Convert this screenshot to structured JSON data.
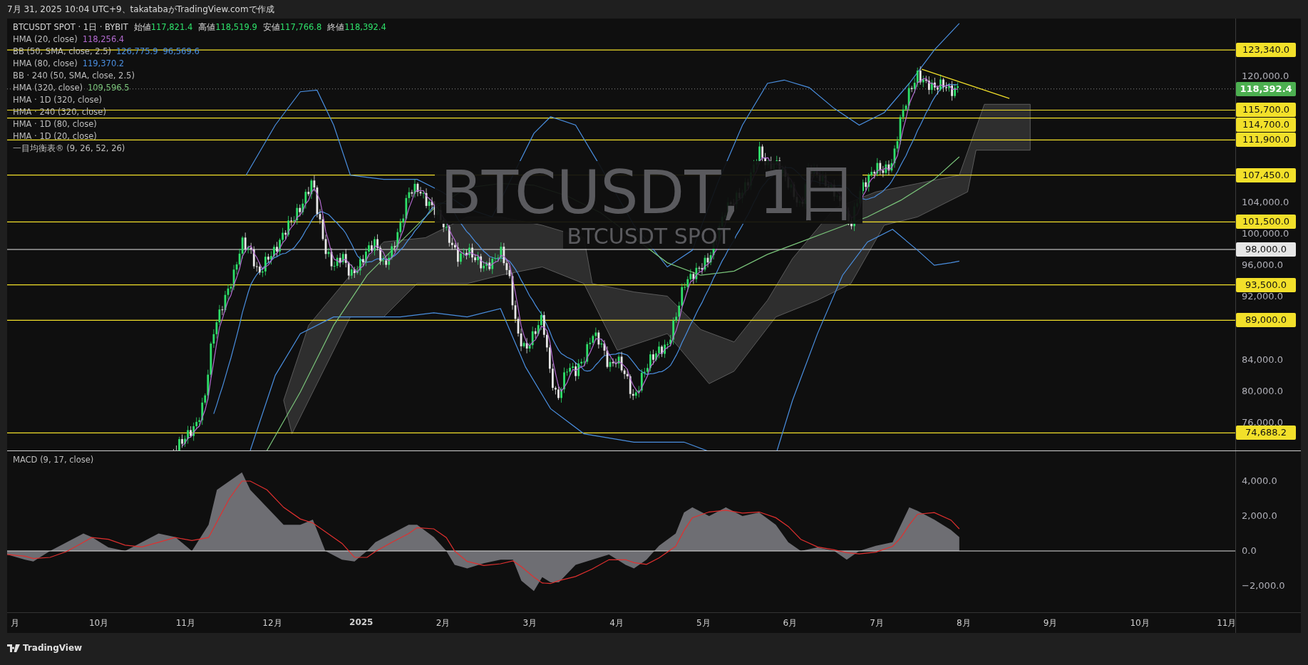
{
  "header": {
    "caption": "7月 31, 2025 10:04 UTC+9、takatabaがTradingView.comで作成"
  },
  "legend": {
    "symbol": "BTCUSDT SPOT · 1日 · BYBIT",
    "ohlc": [
      {
        "label": "始値",
        "value": "117,821.4"
      },
      {
        "label": "高値",
        "value": "118,519.9"
      },
      {
        "label": "安値",
        "value": "117,766.8"
      },
      {
        "label": "終値",
        "value": "118,392.4"
      }
    ],
    "indicators": [
      {
        "name": "HMA (20, close)",
        "values": [
          {
            "text": "118,256.4",
            "color": "#b36ad0"
          }
        ]
      },
      {
        "name": "BB (50, SMA, close, 2.5)",
        "values": [
          {
            "text": "126,775.9",
            "color": "#4a8fe0"
          },
          {
            "text": "96,569.6",
            "color": "#4a8fe0"
          }
        ]
      },
      {
        "name": "HMA (80, close)",
        "values": [
          {
            "text": "119,370.2",
            "color": "#4a8fe0"
          }
        ]
      },
      {
        "name": "BB · 240 (50, SMA, close, 2.5)"
      },
      {
        "name": "HMA (320, close)",
        "values": [
          {
            "text": "109,596.5",
            "color": "#7ac47a"
          }
        ]
      },
      {
        "name": "HMA · 1D (320, close)"
      },
      {
        "name": "HMA · 240 (320, close)"
      },
      {
        "name": "HMA · 1D (80, close)"
      },
      {
        "name": "HMA · 1D (20, close)"
      },
      {
        "name": "一目均衡表® (9, 26, 52, 26)"
      }
    ]
  },
  "watermark": {
    "title": "BTCUSDT, 1日",
    "subtitle": "BTCUSDT SPOT"
  },
  "price_axis": {
    "ticks": [
      "120,000.0",
      "104,000.0",
      "100,000.0",
      "96,000.0",
      "92,000.0",
      "84,000.0",
      "80,000.0",
      "76,000.0"
    ]
  },
  "price_levels": [
    {
      "label": "123,340.0",
      "kind": "level",
      "color": "#f2e02a"
    },
    {
      "label": "118,392.4",
      "kind": "last",
      "color": "#4caf50"
    },
    {
      "label": "115,700.0",
      "kind": "level",
      "color": "#f2e02a"
    },
    {
      "label": "114,700.0",
      "kind": "level",
      "color": "#f2e02a"
    },
    {
      "label": "111,900.0",
      "kind": "level",
      "color": "#f2e02a"
    },
    {
      "label": "107,450.0",
      "kind": "level",
      "color": "#f2e02a"
    },
    {
      "label": "101,500.0",
      "kind": "level",
      "color": "#f2e02a"
    },
    {
      "label": "98,000.0",
      "kind": "level",
      "color": "#e6e6e6"
    },
    {
      "label": "93,500.0",
      "kind": "level",
      "color": "#f2e02a"
    },
    {
      "label": "89,000.0",
      "kind": "level",
      "color": "#f2e02a"
    },
    {
      "label": "74,688.2",
      "kind": "level",
      "color": "#f2e02a"
    }
  ],
  "macd": {
    "title": "MACD (9, 17, close)",
    "ticks": [
      "4,000.0",
      "2,000.0",
      "0.0",
      "−2,000.0"
    ]
  },
  "time_axis": [
    {
      "label": "月",
      "kind": "month"
    },
    {
      "label": "10月",
      "kind": "month"
    },
    {
      "label": "11月",
      "kind": "month"
    },
    {
      "label": "12月",
      "kind": "month"
    },
    {
      "label": "2025",
      "kind": "year"
    },
    {
      "label": "2月",
      "kind": "month"
    },
    {
      "label": "3月",
      "kind": "month"
    },
    {
      "label": "4月",
      "kind": "month"
    },
    {
      "label": "5月",
      "kind": "month"
    },
    {
      "label": "6月",
      "kind": "month"
    },
    {
      "label": "7月",
      "kind": "month"
    },
    {
      "label": "8月",
      "kind": "month"
    },
    {
      "label": "9月",
      "kind": "month"
    },
    {
      "label": "10月",
      "kind": "month"
    },
    {
      "label": "11月",
      "kind": "month"
    }
  ],
  "footer": {
    "brand": "TradingView"
  }
}
